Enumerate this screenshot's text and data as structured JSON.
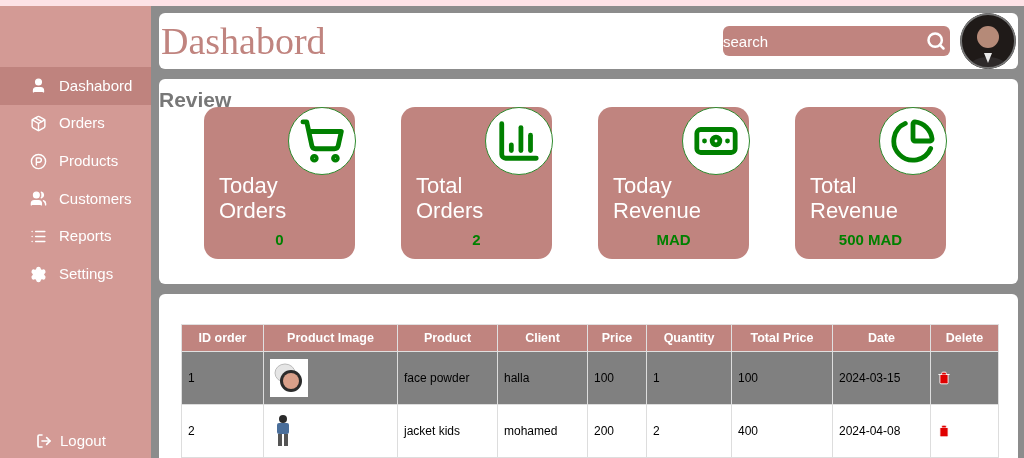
{
  "sidebar": {
    "items": [
      {
        "label": "Dashabord",
        "selected": true
      },
      {
        "label": "Orders",
        "selected": false
      },
      {
        "label": "Products",
        "selected": false
      },
      {
        "label": "Customers",
        "selected": false
      },
      {
        "label": "Reports",
        "selected": false
      },
      {
        "label": "Settings",
        "selected": false
      }
    ],
    "logout": "Logout"
  },
  "header": {
    "title": "Dashabord",
    "search": {
      "placeholder": "search"
    }
  },
  "review": {
    "title": "Review",
    "cards": [
      {
        "label": "Today Orders",
        "value": "0"
      },
      {
        "label": "Total Orders",
        "value": "2"
      },
      {
        "label": "Today Revenue",
        "value": "MAD"
      },
      {
        "label": "Total Revenue",
        "value": "500 MAD"
      }
    ]
  },
  "table": {
    "columns": [
      "ID order",
      "Product Image",
      "Product",
      "Client",
      "Price",
      "Quantity",
      "Total Price",
      "Date",
      "Delete"
    ],
    "rows": [
      {
        "id": "1",
        "product": "face powder",
        "client": "halla",
        "price": "100",
        "quantity": "1",
        "total": "100",
        "date": "2024-03-15",
        "selected": true
      },
      {
        "id": "2",
        "product": "jacket kids",
        "client": "mohamed",
        "price": "200",
        "quantity": "2",
        "total": "400",
        "date": "2024-04-08",
        "selected": false
      }
    ]
  }
}
